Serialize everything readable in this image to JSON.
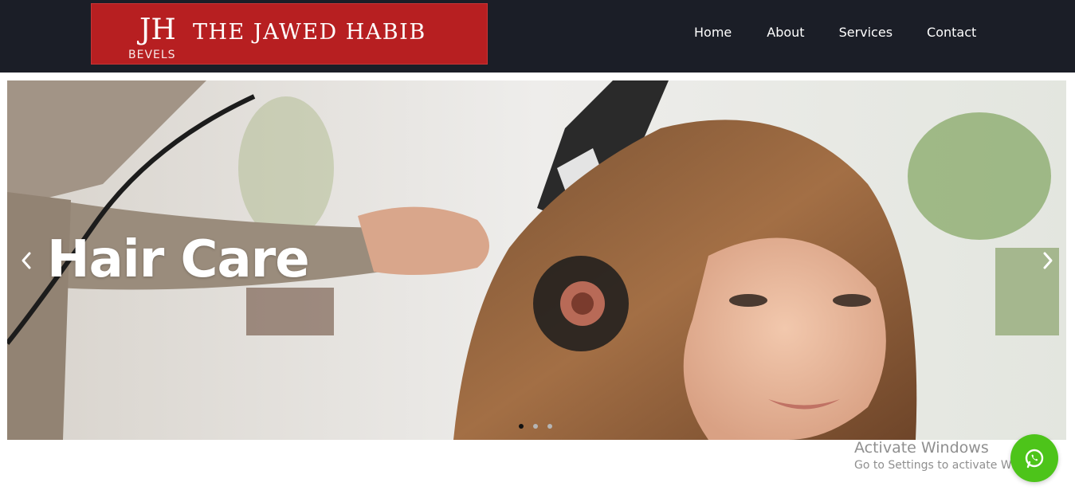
{
  "header": {
    "logo": {
      "title": "THE JAWED HABIB",
      "mark_letters": "JH",
      "mark_subtext": "BEVELS",
      "background_color": "#b71f21"
    },
    "nav": [
      {
        "label": "Home"
      },
      {
        "label": "About"
      },
      {
        "label": "Services"
      },
      {
        "label": "Contact"
      }
    ],
    "background_color": "#1b1e27"
  },
  "hero": {
    "caption": "Hair Care",
    "prev_icon": "chevron-left-icon",
    "next_icon": "chevron-right-icon",
    "slide_count": 3,
    "active_slide": 1
  },
  "os_watermark": {
    "title": "Activate Windows",
    "subtitle": "Go to Settings to activate Windows."
  },
  "whatsapp": {
    "icon": "whatsapp-icon",
    "color": "#4dc41a"
  }
}
